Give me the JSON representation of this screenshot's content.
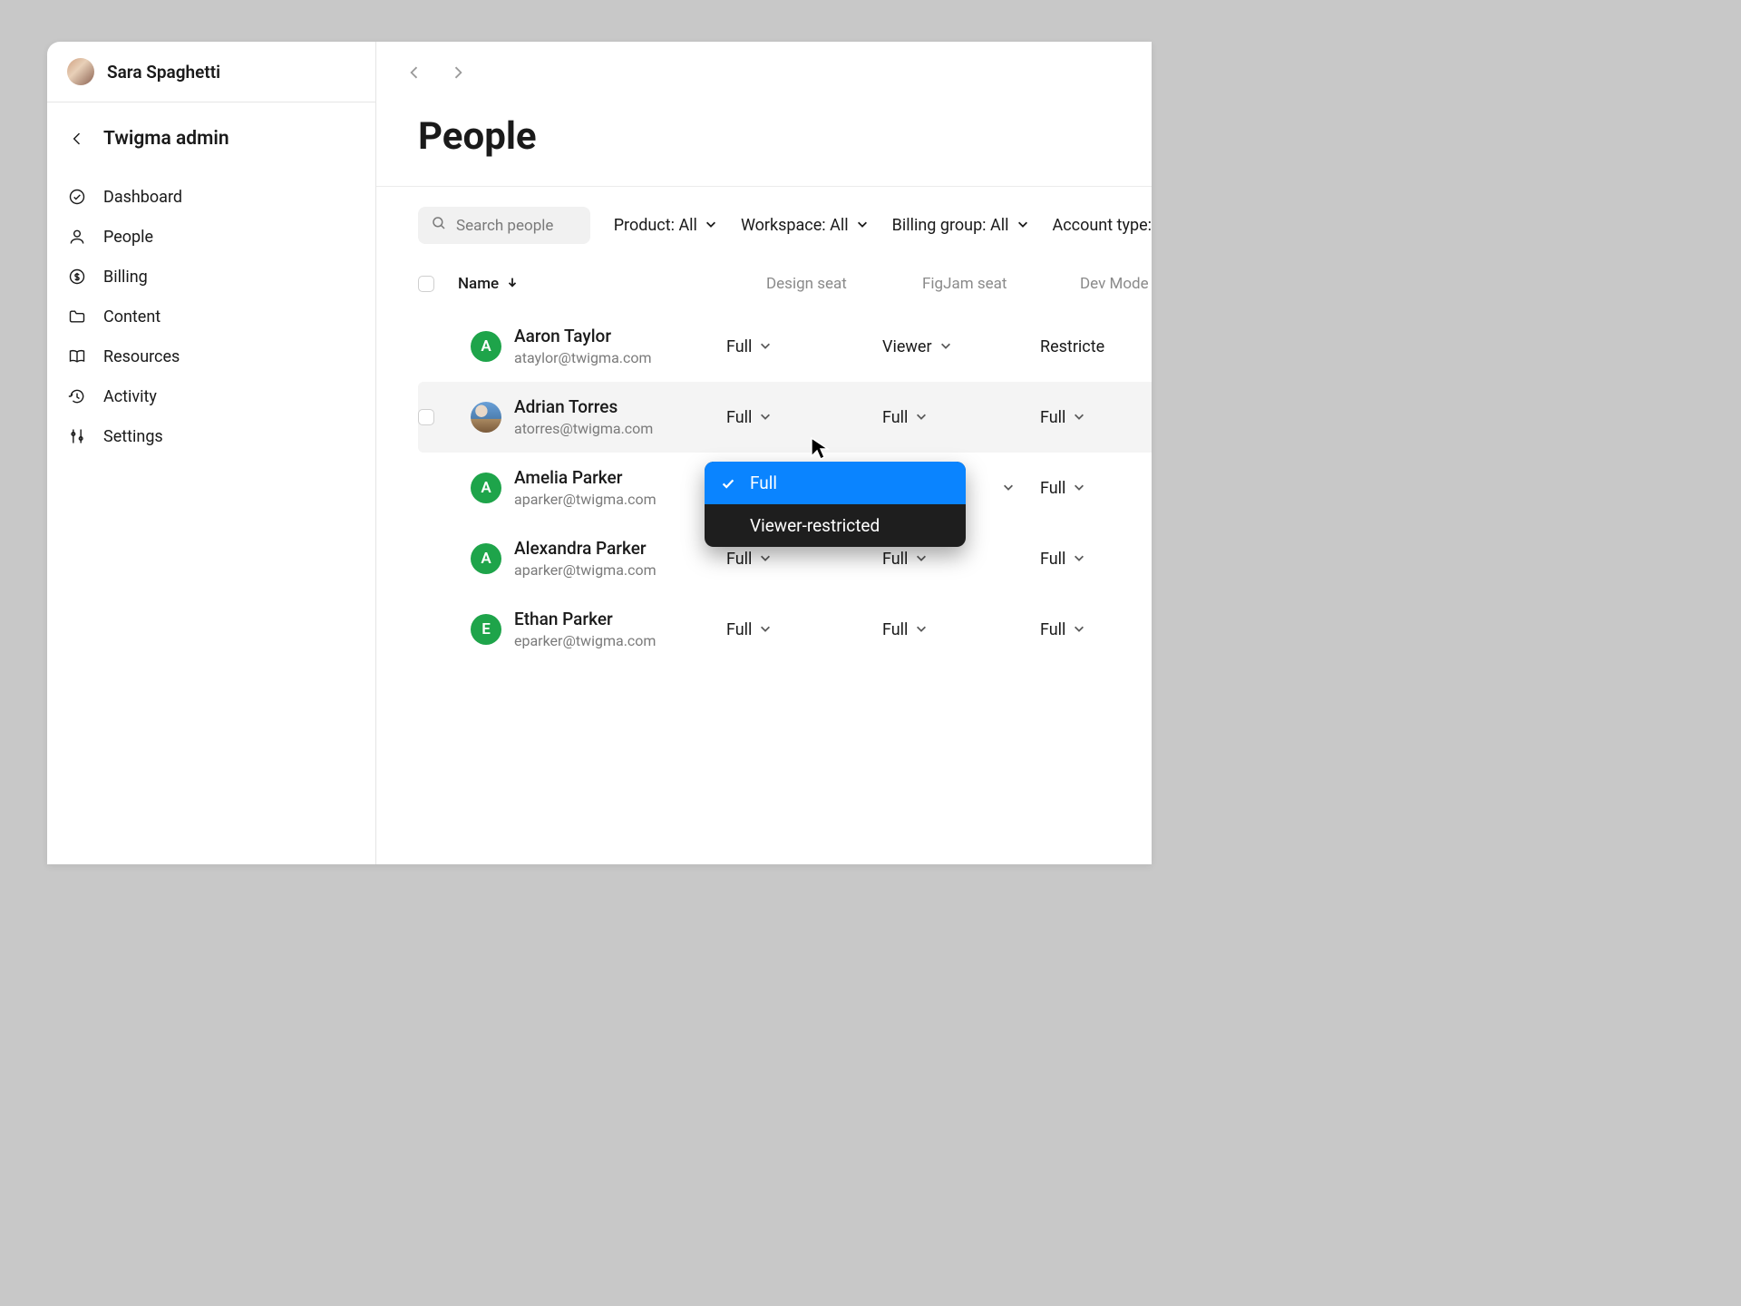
{
  "profile": {
    "name": "Sara Spaghetti"
  },
  "sidebar": {
    "back_label": "Twigma admin",
    "items": [
      {
        "label": "Dashboard"
      },
      {
        "label": "People"
      },
      {
        "label": "Billing"
      },
      {
        "label": "Content"
      },
      {
        "label": "Resources"
      },
      {
        "label": "Activity"
      },
      {
        "label": "Settings"
      }
    ]
  },
  "page": {
    "title": "People"
  },
  "search": {
    "placeholder": "Search people"
  },
  "filters": {
    "product": "Product: All",
    "workspace": "Workspace: All",
    "billing_group": "Billing group: All",
    "account_type": "Account type:"
  },
  "columns": {
    "name": "Name",
    "design": "Design seat",
    "figjam": "FigJam seat",
    "devmode": "Dev Mode"
  },
  "rows": [
    {
      "initial": "A",
      "name": "Aaron Taylor",
      "email": "ataylor@twigma.com",
      "design": "Full",
      "figjam": "Viewer",
      "dev": "Restricte"
    },
    {
      "initial": "",
      "name": "Adrian Torres",
      "email": "atorres@twigma.com",
      "design": "Full",
      "figjam": "Full",
      "dev": "Full"
    },
    {
      "initial": "A",
      "name": "Amelia Parker",
      "email": "aparker@twigma.com",
      "design": "",
      "figjam": "",
      "dev": "Full"
    },
    {
      "initial": "A",
      "name": "Alexandra Parker",
      "email": "aparker@twigma.com",
      "design": "Full",
      "figjam": "Full",
      "dev": "Full"
    },
    {
      "initial": "E",
      "name": "Ethan Parker",
      "email": "eparker@twigma.com",
      "design": "Full",
      "figjam": "Full",
      "dev": "Full"
    }
  ],
  "menu": {
    "option_full": "Full",
    "option_viewer_restricted": "Viewer-restricted"
  }
}
